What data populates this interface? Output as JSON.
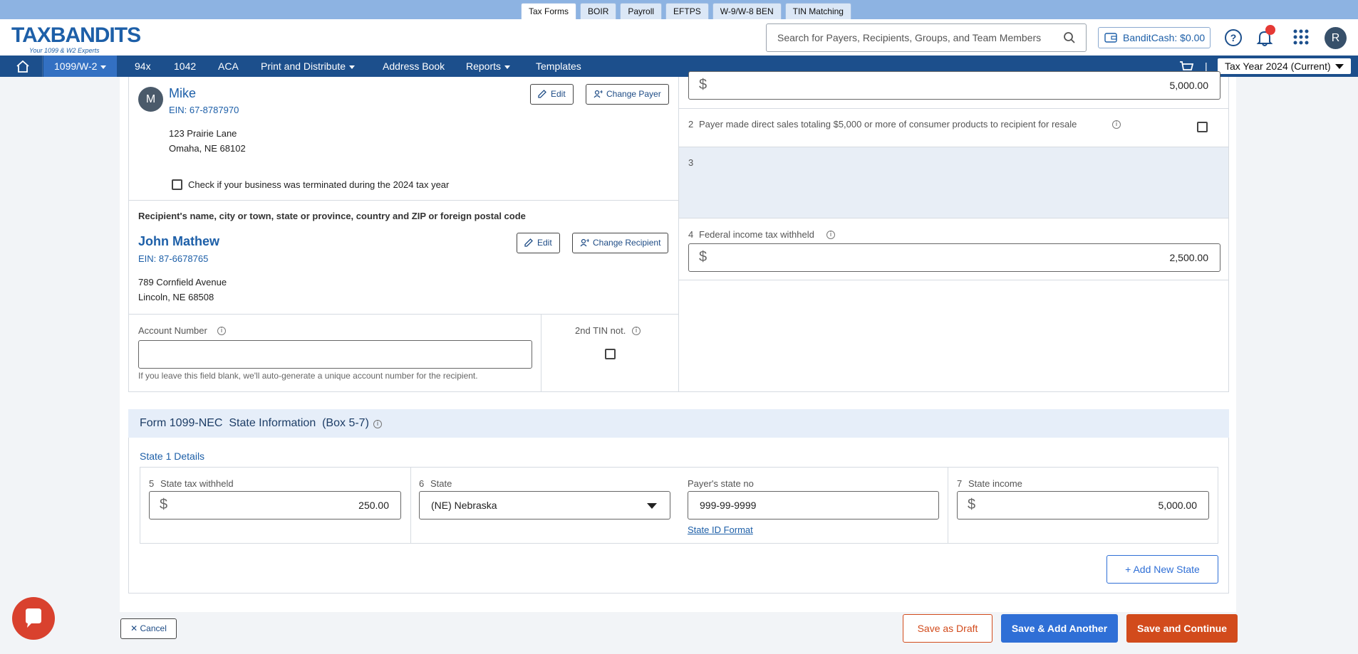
{
  "top_tabs": [
    "Tax Forms",
    "BOIR",
    "Payroll",
    "EFTPS",
    "W-9/W-8 BEN",
    "TIN Matching"
  ],
  "brand": {
    "logo": "TAXBANDITS",
    "tagline": "Your 1099 & W2 Experts"
  },
  "header": {
    "search_placeholder": "Search for Payers, Recipients, Groups, and Team Members",
    "bandit_cash_label": "BanditCash: $0.00",
    "avatar_initial": "R"
  },
  "nav": {
    "items": [
      "1099/W-2",
      "94x",
      "1042",
      "ACA",
      "Print and Distribute",
      "Address Book",
      "Reports",
      "Templates"
    ],
    "tax_year": "Tax Year 2024 (Current)",
    "separator": "|"
  },
  "payer": {
    "avatar": "M",
    "name": "Mike",
    "ein": "EIN: 67-8787970",
    "address1": "123 Prairie Lane",
    "address2": "Omaha, NE 68102",
    "edit_label": "Edit",
    "change_label": "Change Payer",
    "terminated_label": "Check if your business was terminated during the 2024 tax year"
  },
  "recipient": {
    "section_label": "Recipient's name, city or town, state or province, country and ZIP or foreign postal code",
    "name": "John Mathew",
    "ein": "EIN: 87-6678765",
    "address1": "789 Cornfield Avenue",
    "address2": "Lincoln, NE 68508",
    "edit_label": "Edit",
    "change_label": "Change Recipient"
  },
  "account": {
    "label": "Account Number",
    "value": "",
    "help": "If you leave this field blank, we'll auto-generate a unique account number for the recipient.",
    "tin_label": "2nd TIN not."
  },
  "boxes": {
    "box1_value": "5,000.00",
    "box2_num": "2",
    "box2_label": "Payer made direct sales totaling $5,000 or more of consumer products to recipient for resale",
    "box3_num": "3",
    "box4_num": "4",
    "box4_label": "Federal income tax withheld",
    "box4_value": "2,500.00",
    "currency": "$"
  },
  "state_info": {
    "title": "Form 1099-NEC  State Information  (Box 5-7)",
    "state1_label": "State 1 Details",
    "box5_num": "5",
    "box5_label": "State tax withheld",
    "box5_value": "250.00",
    "box6_num": "6",
    "box6_label": "State",
    "box6_value": "(NE) Nebraska",
    "payer_state_label": "Payer's state no",
    "payer_state_value": "999-99-9999",
    "state_id_link": "State ID Format",
    "box7_num": "7",
    "box7_label": "State income",
    "box7_value": "5,000.00",
    "add_state": "Add New State"
  },
  "footer": {
    "cancel": "Cancel",
    "save_draft": "Save as Draft",
    "save_add": "Save & Add Another",
    "save_continue": "Save and Continue"
  },
  "colors": {
    "primary": "#1c4f8c",
    "accent_blue": "#2f6fd6",
    "accent_orange": "#d24b1c",
    "notification": "#e53935"
  }
}
